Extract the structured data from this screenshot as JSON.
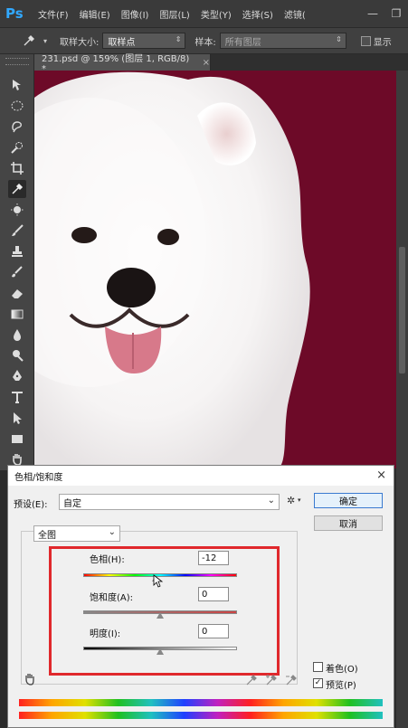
{
  "app": {
    "logo": "Ps"
  },
  "menu": [
    "文件(F)",
    "编辑(E)",
    "图像(I)",
    "图层(L)",
    "类型(Y)",
    "选择(S)",
    "滤镜("
  ],
  "window_controls": {
    "minimize": "—",
    "restore": "❐"
  },
  "options_bar": {
    "sample_size_label": "取样大小:",
    "sample_size_value": "取样点",
    "sample_label": "样本:",
    "sample_value": "所有图层",
    "show_ring_label": "显示"
  },
  "document_tab": {
    "title": "231.psd @ 159% (图层 1, RGB/8) *",
    "close": "×"
  },
  "canvas": {
    "background_color": "#6d0a28"
  },
  "dialog": {
    "title": "色相/饱和度",
    "close": "×",
    "preset_label": "预设(E):",
    "preset_value": "自定",
    "ok_label": "确定",
    "cancel_label": "取消",
    "channel_value": "全图",
    "hue_label": "色相(H):",
    "hue_value": "-12",
    "saturation_label": "饱和度(A):",
    "saturation_value": "0",
    "lightness_label": "明度(I):",
    "lightness_value": "0",
    "colorize_label": "着色(O)",
    "colorize_checked": false,
    "preview_label": "预览(P)",
    "preview_checked": true,
    "hue_slider_level": 0.47,
    "saturation_slider_level": 0.5,
    "lightness_slider_level": 0.5,
    "highlight_color": "#e0282c"
  },
  "icons": {
    "gear": "gear-icon",
    "hand": "hand-icon",
    "eyedropper": "eyedropper-icon"
  }
}
